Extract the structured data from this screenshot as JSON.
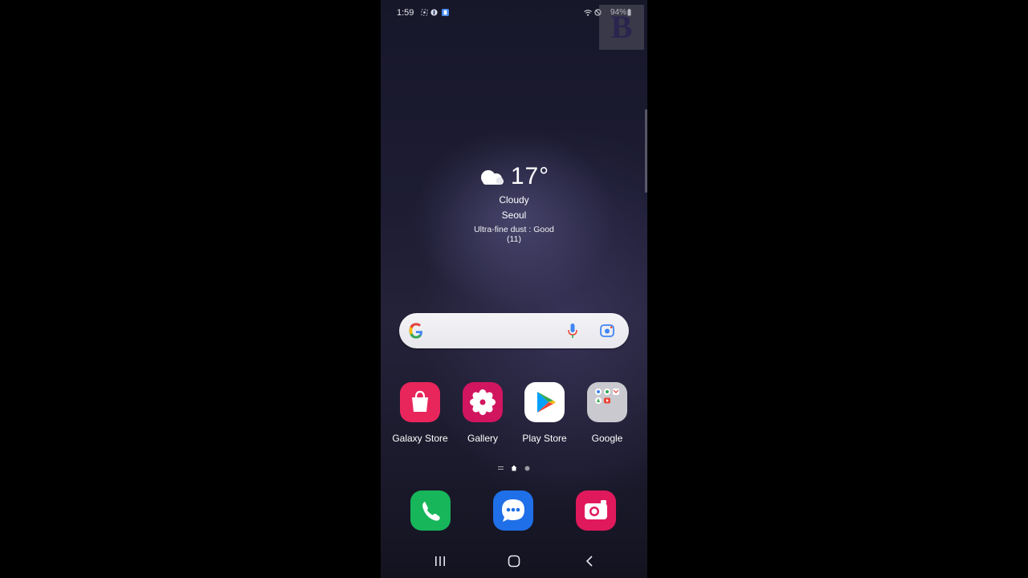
{
  "status_bar": {
    "time": "1:59",
    "battery": "94%"
  },
  "watermark": {
    "letter": "B"
  },
  "weather": {
    "temperature": "17°",
    "condition": "Cloudy",
    "city": "Seoul",
    "dust_line1": "Ultra-fine dust : Good",
    "dust_line2": "(11)",
    "icon": "cloud-icon"
  },
  "search": {
    "placeholder": "",
    "icons": [
      "google-g-icon",
      "microphone-icon",
      "lens-icon"
    ]
  },
  "apps": [
    {
      "label": "Galaxy Store",
      "icon": "shopping-bag-icon",
      "color": "#e8265b"
    },
    {
      "label": "Gallery",
      "icon": "flower-icon",
      "color": "#d1155f"
    },
    {
      "label": "Play Store",
      "icon": "play-triangle-icon",
      "color": "#ffffff"
    },
    {
      "label": "Google",
      "icon": "folder-icon",
      "color": "#c9c9cf"
    }
  ],
  "dock": [
    {
      "icon": "phone-icon",
      "color": "#17b65a"
    },
    {
      "icon": "messages-icon",
      "color": "#1f6fe8"
    },
    {
      "icon": "camera-icon",
      "color": "#e0195c"
    }
  ],
  "page_indicator": {
    "pages": 2,
    "current": 1
  },
  "colors": {
    "background": "#000000",
    "text": "#ffffff"
  }
}
